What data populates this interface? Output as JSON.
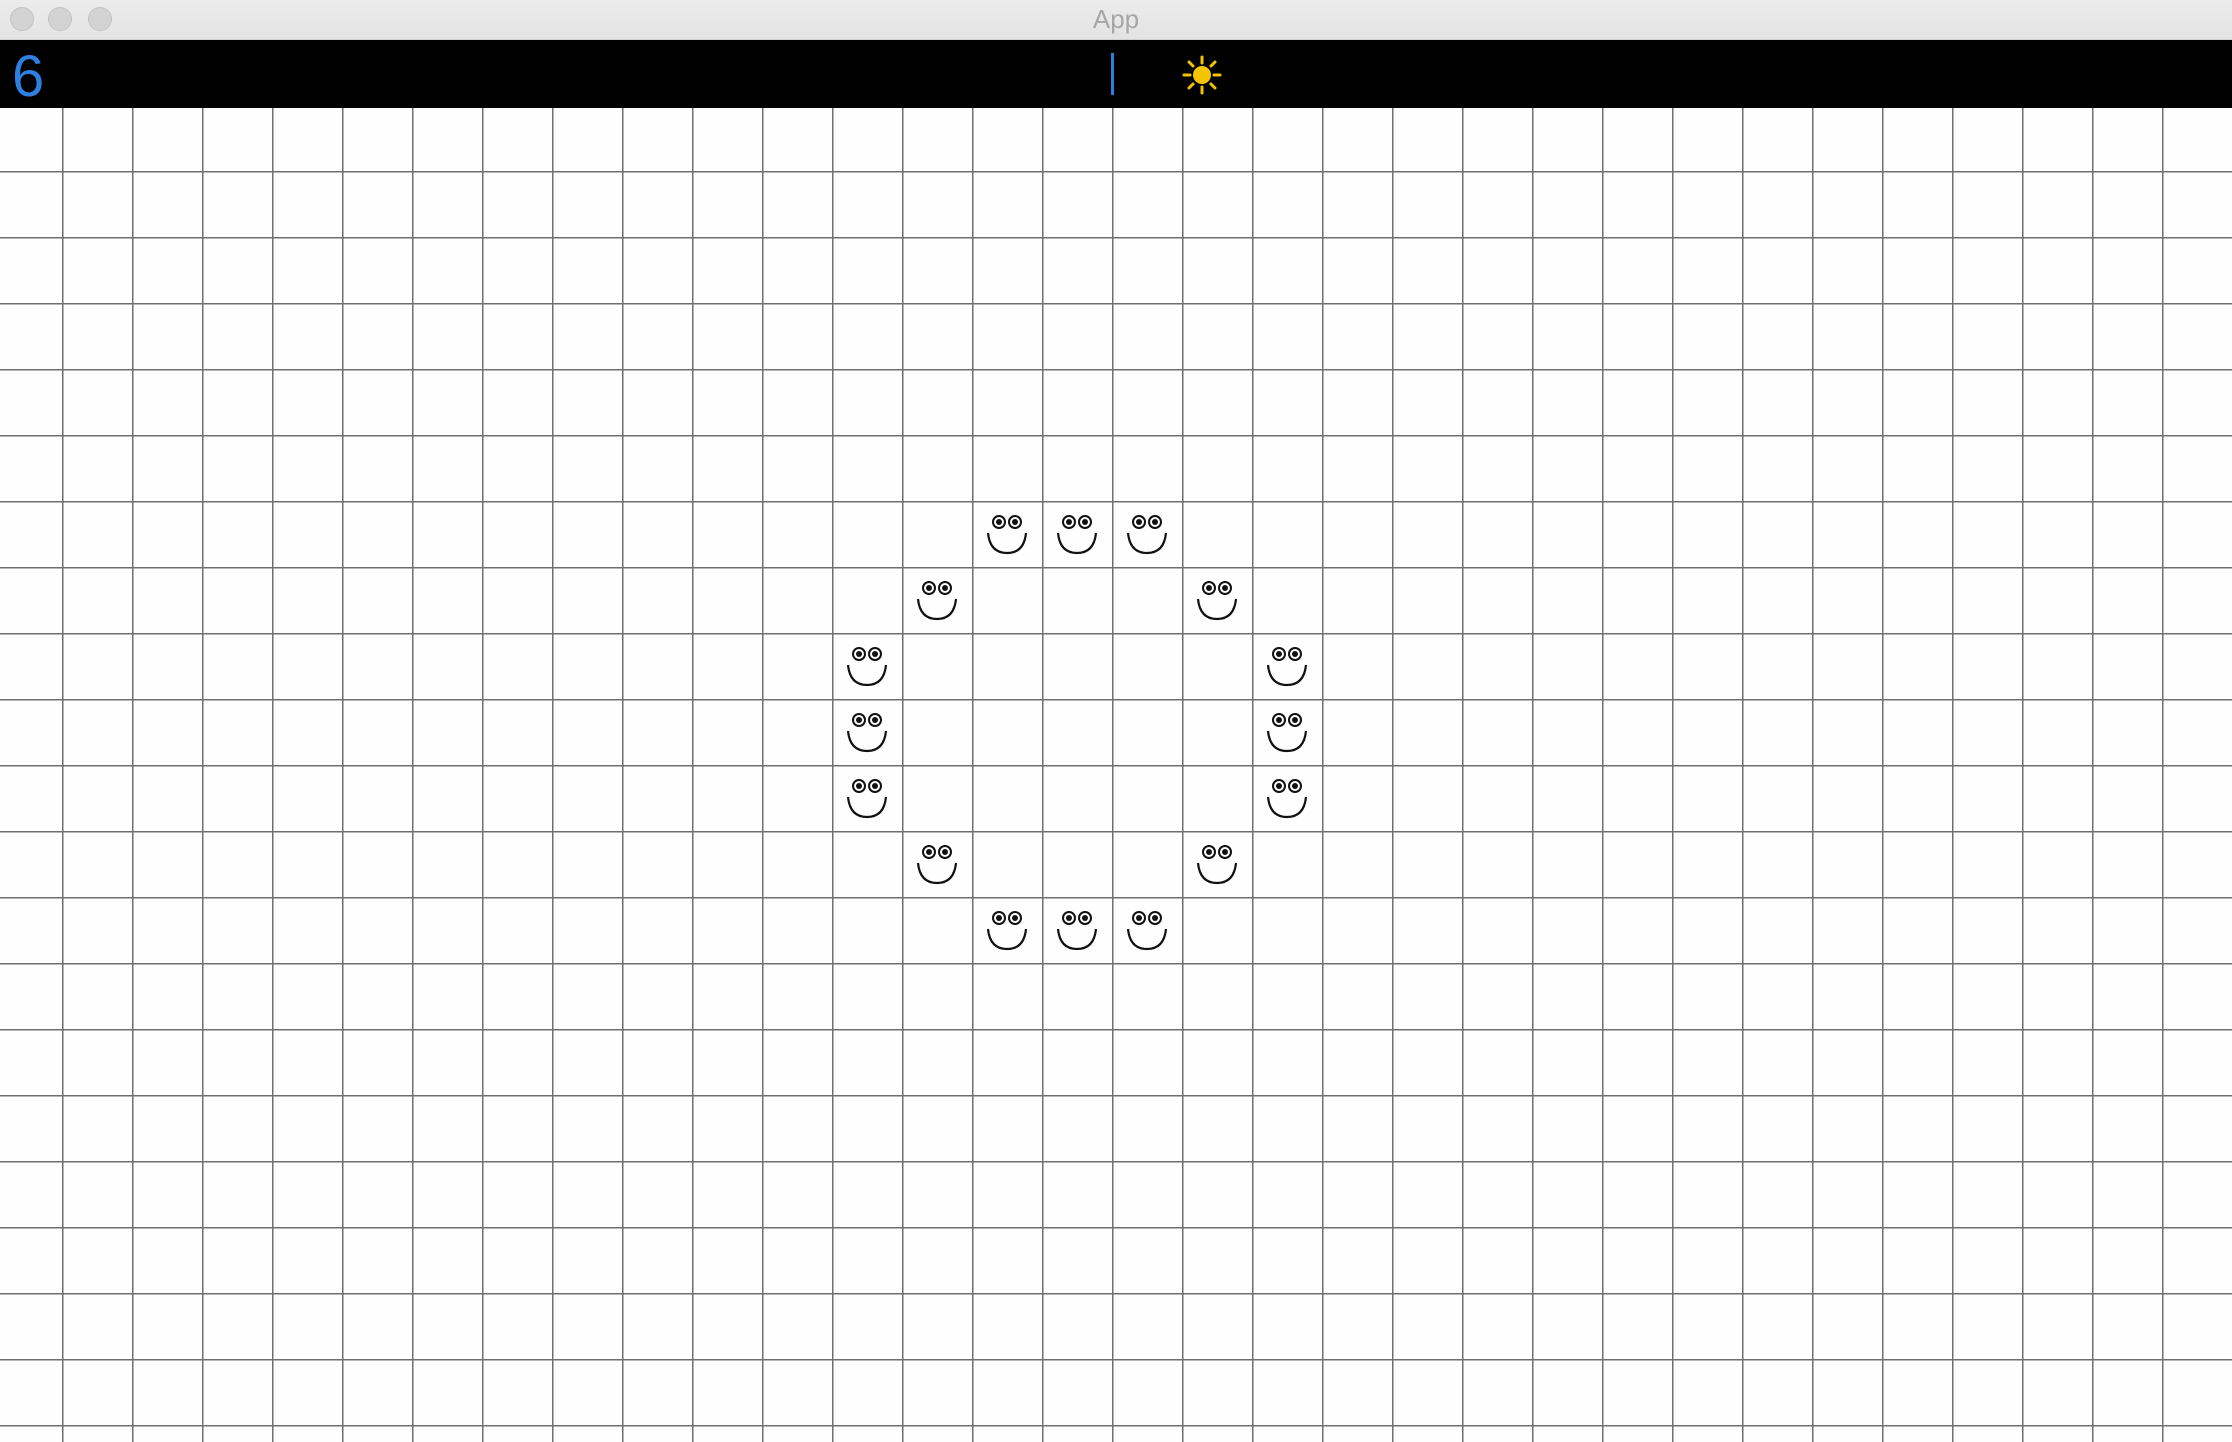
{
  "window": {
    "title": "App"
  },
  "toolbar": {
    "counter": "6",
    "counter_color": "#2d7fe0",
    "cursor_color": "#2d7fe0",
    "status_icon": "sun-icon",
    "sun_color": "#f5c400"
  },
  "board": {
    "columns": 32,
    "rows": 20,
    "cell_icon": "smiley-face-icon",
    "grid_color": "#6f6f6f",
    "smileys": [
      {
        "col": 14,
        "row": 6
      },
      {
        "col": 15,
        "row": 6
      },
      {
        "col": 16,
        "row": 6
      },
      {
        "col": 13,
        "row": 7
      },
      {
        "col": 17,
        "row": 7
      },
      {
        "col": 12,
        "row": 8
      },
      {
        "col": 18,
        "row": 8
      },
      {
        "col": 12,
        "row": 9
      },
      {
        "col": 18,
        "row": 9
      },
      {
        "col": 12,
        "row": 10
      },
      {
        "col": 18,
        "row": 10
      },
      {
        "col": 13,
        "row": 11
      },
      {
        "col": 17,
        "row": 11
      },
      {
        "col": 14,
        "row": 12
      },
      {
        "col": 15,
        "row": 12
      },
      {
        "col": 16,
        "row": 12
      }
    ]
  }
}
